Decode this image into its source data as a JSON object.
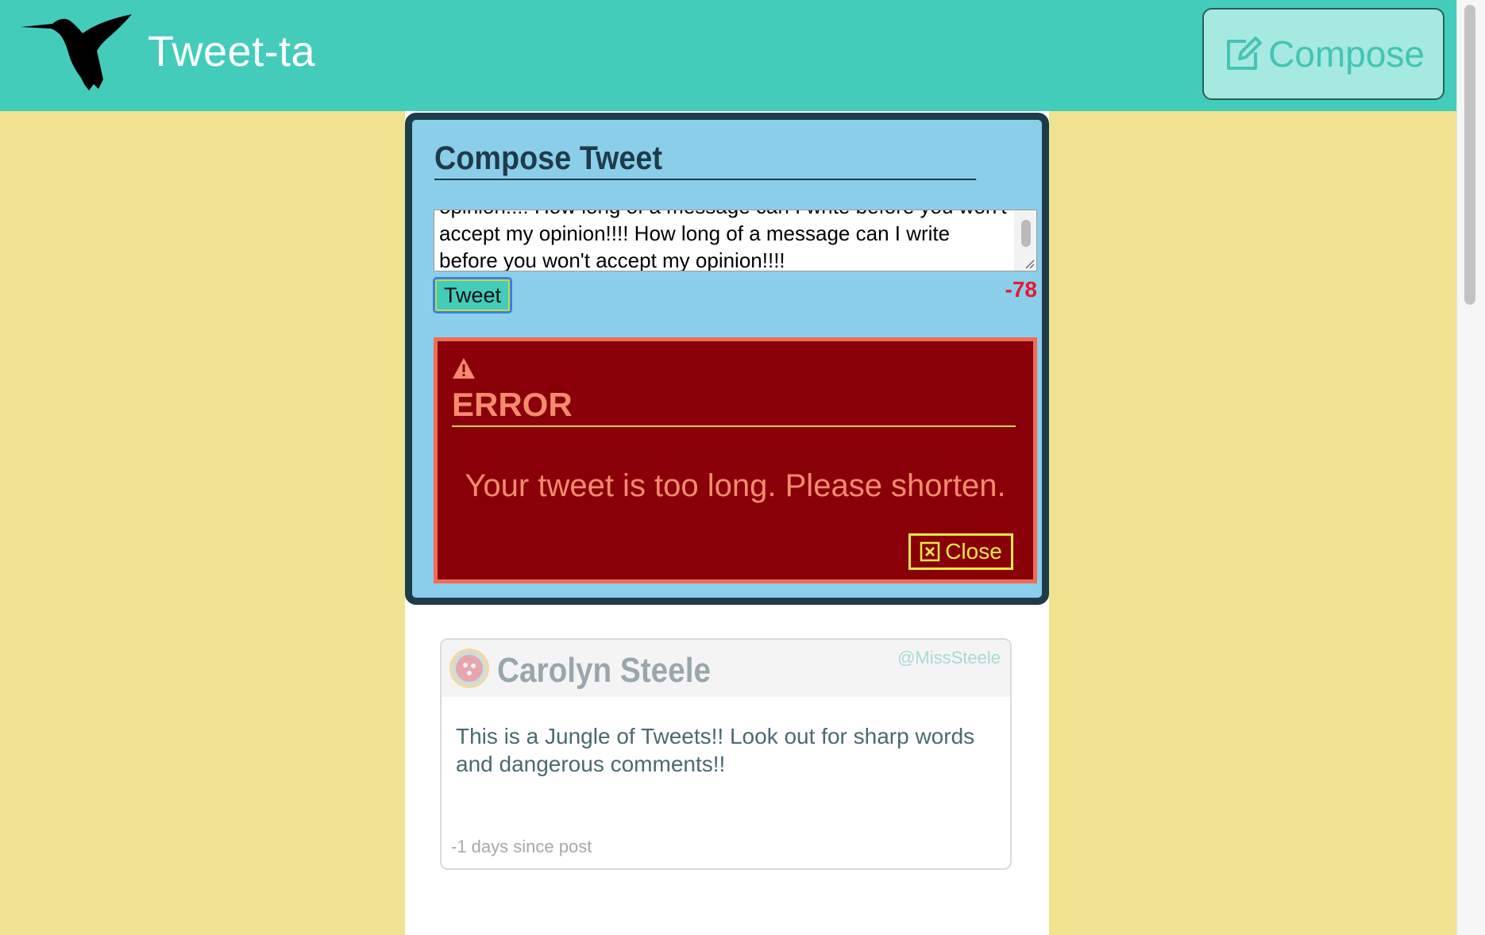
{
  "header": {
    "brand": "Tweet-ta",
    "logo_icon": "hummingbird-icon",
    "compose_label": "Compose",
    "compose_icon": "edit-icon",
    "bg_color": "#44ccbb"
  },
  "compose": {
    "title": "Compose Tweet",
    "text": "opinion!!!! How long of a message can I write before you won't accept my opinion!!!! How long of a message can I write before you won't accept my opinion!!!!",
    "tweet_label": "Tweet",
    "char_counter": "-78"
  },
  "error": {
    "icon": "warning-icon",
    "title": "ERROR",
    "message": "Your tweet is too long. Please shorten.",
    "close_label": "Close",
    "close_icon": "close-square-icon"
  },
  "tweets": [
    {
      "name": "Carolyn Steele",
      "handle": "@MissSteele",
      "text": "This is a Jungle of Tweets!! Look out for sharp words and dangerous comments!!",
      "time": "-1 days since post"
    }
  ],
  "colors": {
    "page_bg": "#efe390",
    "panel_bg": "#8bceea",
    "error_bg": "#8a0008",
    "error_text": "#f58a6f",
    "counter": "#e8172c"
  }
}
